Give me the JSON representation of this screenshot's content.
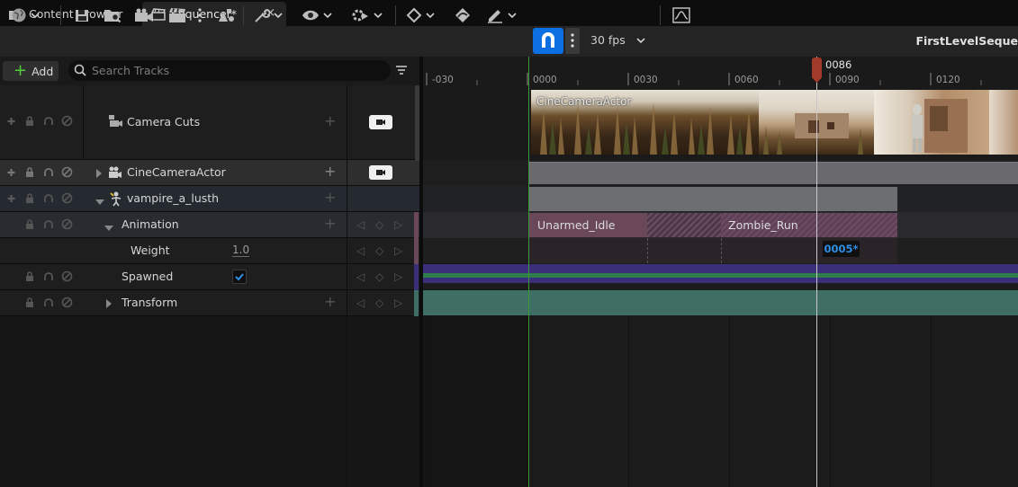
{
  "tabs": [
    {
      "label": "Content Browser",
      "icon": "folder-icon"
    },
    {
      "label": "Sequencer*",
      "icon": "clapperboard-icon",
      "close": "×"
    }
  ],
  "toolbar": {
    "fps": "30 fps",
    "sequence_title": "FirstLevelSeque"
  },
  "tracks_panel": {
    "add_label": "Add",
    "search_placeholder": "Search Tracks"
  },
  "tracks": [
    {
      "name": "Camera Cuts"
    },
    {
      "name": "CineCameraActor"
    },
    {
      "name": "vampire_a_lusth"
    },
    {
      "name": "Animation"
    },
    {
      "name": "Weight",
      "value": "1.0"
    },
    {
      "name": "Spawned",
      "checked": true
    },
    {
      "name": "Transform"
    }
  ],
  "timeline": {
    "ticks": [
      "-030",
      "0000",
      "0030",
      "0060",
      "0090",
      "0120"
    ],
    "playhead": "0086",
    "current_value": "0005*",
    "camera_section_label": "CineCameraActor",
    "anim_sections": [
      "Unarmed_Idle",
      "Zombie_Run"
    ]
  },
  "colors": {
    "accent": "#0c70e2",
    "playhead": "#a23a2a",
    "anim_section": "#5e3f52",
    "spawn_track": "#3b2f7a",
    "transform_track": "#3f6e64",
    "add_plus": "#4fcf3a"
  }
}
